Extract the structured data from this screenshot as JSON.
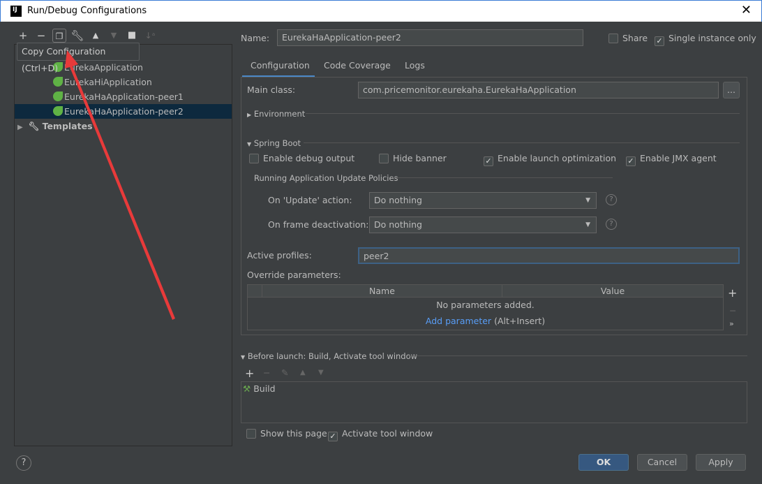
{
  "window": {
    "title": "Run/Debug Configurations",
    "app_icon": "intellij-icon",
    "close": "✕"
  },
  "toolbar": {
    "add": "+",
    "remove": "−",
    "copy_tooltip": "Copy Configuration (Ctrl+D)"
  },
  "tree": {
    "items": [
      {
        "label": "EurekaApplication",
        "icon": "spring-boot-icon"
      },
      {
        "label": "EurekaHiApplication",
        "icon": "spring-boot-icon"
      },
      {
        "label": "EurekaHaApplication-peer1",
        "icon": "spring-boot-icon"
      },
      {
        "label": "EurekaHaApplication-peer2",
        "icon": "spring-boot-icon",
        "selected": true
      }
    ],
    "templates": "Templates"
  },
  "name": {
    "label": "Name:",
    "value": "EurekaHaApplication-peer2"
  },
  "share": {
    "label": "Share",
    "checked": false
  },
  "single_instance": {
    "label": "Single instance only",
    "checked": true
  },
  "tabs": [
    "Configuration",
    "Code Coverage",
    "Logs"
  ],
  "config": {
    "main_class_label": "Main class:",
    "main_class": "com.pricemonitor.eurekaha.EurekaHaApplication",
    "browse": "...",
    "environment": "Environment",
    "spring_boot": "Spring Boot",
    "checks": [
      {
        "label": "Enable debug output",
        "checked": false
      },
      {
        "label": "Hide banner",
        "checked": false
      },
      {
        "label": "Enable launch optimization",
        "checked": true
      },
      {
        "label": "Enable JMX agent",
        "checked": true
      }
    ],
    "policies_title": "Running Application Update Policies",
    "update_label": "On 'Update' action:",
    "update_value": "Do nothing",
    "frame_label": "On frame deactivation:",
    "frame_value": "Do nothing",
    "active_profiles_label": "Active profiles:",
    "active_profiles": "peer2",
    "override_label": "Override parameters:",
    "table_headers": [
      "Name",
      "Value"
    ],
    "empty": "No parameters added.",
    "add_param": "Add parameter",
    "add_param_shortcut": "(Alt+Insert)"
  },
  "before_launch": {
    "title": "Before launch: Build, Activate tool window",
    "items": [
      "Build"
    ]
  },
  "show_page": {
    "label": "Show this page",
    "checked": false
  },
  "activate_tool": {
    "label": "Activate tool window",
    "checked": true
  },
  "buttons": {
    "ok": "OK",
    "cancel": "Cancel",
    "apply": "Apply",
    "help": "?"
  },
  "colors": {
    "accent": "#365880",
    "selection": "#0d293e",
    "annotation_arrow": "#e83a3a"
  }
}
